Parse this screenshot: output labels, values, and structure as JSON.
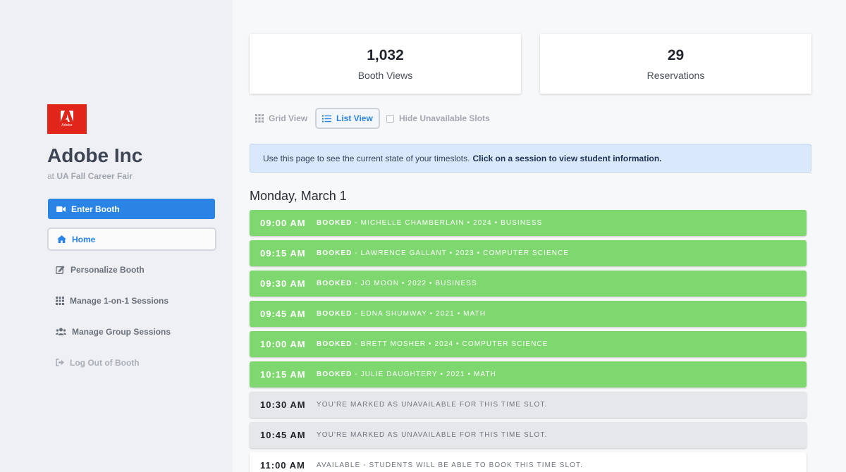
{
  "sidebar": {
    "logo_text": "Adobe",
    "company_name": "Adobe Inc",
    "event_prefix": "at",
    "event_name": "UA Fall Career Fair",
    "enter_booth_label": "Enter Booth",
    "nav": [
      {
        "label": "Home",
        "icon": "home-icon",
        "active": true
      },
      {
        "label": "Personalize Booth",
        "icon": "edit-icon"
      },
      {
        "label": "Manage 1-on-1 Sessions",
        "icon": "grid-icon"
      },
      {
        "label": "Manage Group Sessions",
        "icon": "users-icon"
      },
      {
        "label": "Log Out of Booth",
        "icon": "sign-out-icon",
        "disabled": true
      }
    ]
  },
  "stats": [
    {
      "value": "1,032",
      "label": "Booth Views"
    },
    {
      "value": "29",
      "label": "Reservations"
    }
  ],
  "view_options": {
    "grid_label": "Grid View",
    "list_label": "List View",
    "selected": "list",
    "hide_unavailable_label": "Hide Unavailable Slots",
    "hide_unavailable_checked": false
  },
  "banner": {
    "text": "Use this page to see the current state of your timeslots.",
    "bold_text": "Click on a session to view student information."
  },
  "date_heading": "Monday, March 1",
  "slots": [
    {
      "time": "09:00 AM",
      "status": "BOOKED",
      "detail": " - MICHELLE CHAMBERLAIN • 2024 • BUSINESS",
      "state": "booked"
    },
    {
      "time": "09:15 AM",
      "status": "BOOKED",
      "detail": " - LAWRENCE GALLANT • 2023 • COMPUTER SCIENCE",
      "state": "booked"
    },
    {
      "time": "09:30 AM",
      "status": "BOOKED",
      "detail": " - JO MOON • 2022 • BUSINESS",
      "state": "booked"
    },
    {
      "time": "09:45 AM",
      "status": "BOOKED",
      "detail": " - EDNA SHUMWAY • 2021 • MATH",
      "state": "booked"
    },
    {
      "time": "10:00 AM",
      "status": "BOOKED",
      "detail": " - BRETT MOSHER • 2024 • COMPUTER SCIENCE",
      "state": "booked"
    },
    {
      "time": "10:15 AM",
      "status": "BOOKED",
      "detail": " - JULIE DAUGHTERY • 2021 • MATH",
      "state": "booked"
    },
    {
      "time": "10:30 AM",
      "status": "",
      "detail": "YOU'RE MARKED AS UNAVAILABLE FOR THIS TIME SLOT.",
      "state": "unavailable"
    },
    {
      "time": "10:45 AM",
      "status": "",
      "detail": "YOU'RE MARKED AS UNAVAILABLE FOR THIS TIME SLOT.",
      "state": "unavailable"
    },
    {
      "time": "11:00 AM",
      "status": "",
      "detail": "AVAILABLE - STUDENTS WILL BE ABLE TO BOOK THIS TIME SLOT.",
      "state": "available"
    }
  ],
  "colors": {
    "accent": "#2a84e6",
    "booked": "#7ed86f",
    "unavailable": "#e5e7ea",
    "available": "#ffffff",
    "brand_logo": "#e1251b"
  }
}
